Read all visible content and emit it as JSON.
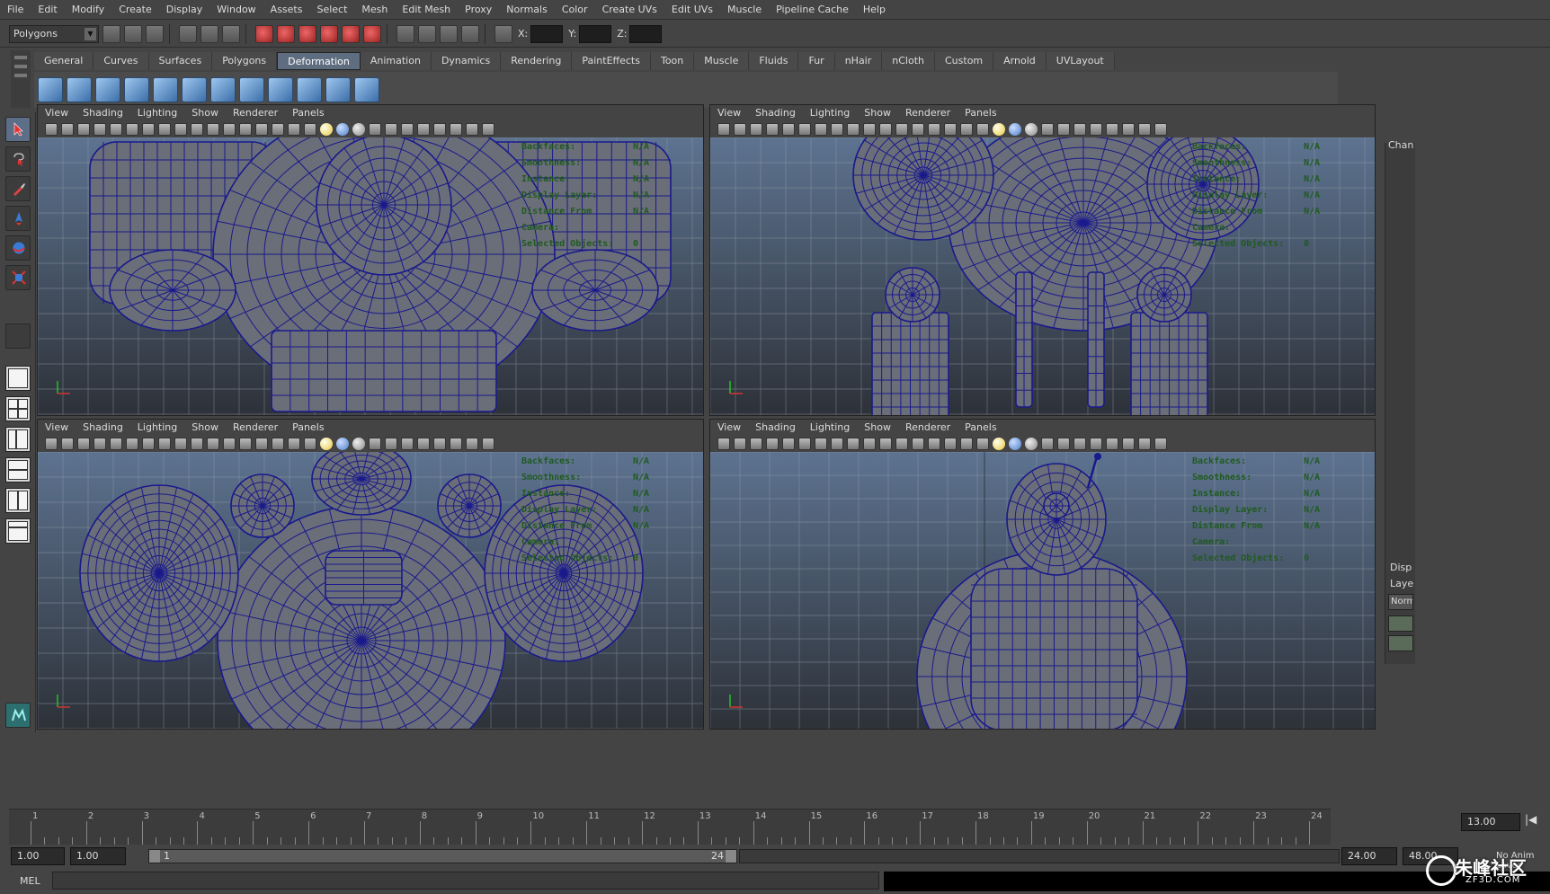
{
  "menubar": {
    "items": [
      "File",
      "Edit",
      "Modify",
      "Create",
      "Display",
      "Window",
      "Assets",
      "Select",
      "Mesh",
      "Edit Mesh",
      "Proxy",
      "Normals",
      "Color",
      "Create UVs",
      "Edit UVs",
      "Muscle",
      "Pipeline Cache",
      "Help"
    ]
  },
  "statusline": {
    "mode": "Polygons",
    "x_label": "X:",
    "y_label": "Y:",
    "z_label": "Z:"
  },
  "shelf": {
    "tabs": [
      "General",
      "Curves",
      "Surfaces",
      "Polygons",
      "Deformation",
      "Animation",
      "Dynamics",
      "Rendering",
      "PaintEffects",
      "Toon",
      "Muscle",
      "Fluids",
      "Fur",
      "nHair",
      "nCloth",
      "Custom",
      "Arnold",
      "UVLayout"
    ],
    "active_tab": "Deformation"
  },
  "viewport_menu": [
    "View",
    "Shading",
    "Lighting",
    "Show",
    "Renderer",
    "Panels"
  ],
  "hud": {
    "labels": [
      "Backfaces:",
      "Smoothness:",
      "Instance:",
      "Display Layer:",
      "Distance From Camera:",
      "Selected Objects:"
    ],
    "values": [
      "N/A",
      "N/A",
      "N/A",
      "N/A",
      "N/A",
      "0"
    ]
  },
  "viewports": [
    {
      "name": "top-left",
      "view": "front"
    },
    {
      "name": "top-right",
      "view": "side"
    },
    {
      "name": "bottom-left",
      "view": "top"
    },
    {
      "name": "bottom-right",
      "view": "perspective"
    }
  ],
  "colors": {
    "wire": "#1a1a8c",
    "bg_top": "#5d7390",
    "bg_bottom": "#2d3138",
    "grid": "#9aa0aa",
    "accent_tab": "#5f6d80"
  },
  "right_panel": {
    "channel_label": "Chan",
    "display_label": "Disp",
    "layer_label": "Laye",
    "normal_label": "Norm"
  },
  "timeline": {
    "ticks": [
      1,
      2,
      3,
      4,
      5,
      6,
      7,
      8,
      9,
      10,
      11,
      12,
      13,
      14,
      15,
      16,
      17,
      18,
      19,
      20,
      21,
      22,
      23,
      24
    ],
    "current_frame": "13.00"
  },
  "range": {
    "start_time": "1.00",
    "playback_start": "1.00",
    "range_lo": "1",
    "range_hi": "24",
    "playback_end": "24.00",
    "end_time": "48.00",
    "anim_layer": "No Anim Layer"
  },
  "command": {
    "mel_label": "MEL"
  },
  "watermark": {
    "text": "朱峰社区",
    "sub": "ZF3D.COM"
  }
}
